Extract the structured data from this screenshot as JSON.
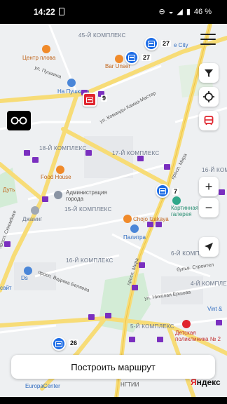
{
  "status_bar": {
    "time": "14:22",
    "battery": "46 %"
  },
  "map": {
    "districts": [
      "45-Й КОМПЛЕКС",
      "18-Й КОМПЛЕКС",
      "17-Й КОМПЛЕКС",
      "15-Й КОМПЛЕКС",
      "16-Й КОМПЛЕКС",
      "6-Й КОМПЛЕКС",
      "5-Й КОМПЛЕКС",
      "4-Й КОМПЛЕКС",
      "16-Й КОМПЛЕКС"
    ],
    "pois": {
      "centr_plova": "Центр плова",
      "bar_unser": "Bar Unser",
      "na_pushkina": "На Пушкина",
      "food_house": "Food House",
      "dut": "Дуть",
      "administraciya": "Администрация города",
      "dzhamig": "Джамиг",
      "kartinnaya": "Картинная галерея",
      "chojo": "Chojo Izakaya",
      "palitra": "Палитра",
      "city": "e City",
      "ds": "Ds",
      "sait": "сайт",
      "vint": "Vint &",
      "detskaya": "Детская поликлиника № 2",
      "europacenter": "EuropaCenter",
      "ngtii": "НГТИИ"
    },
    "streets": {
      "pushkina": "ул. Пушкина",
      "kamaz": "ул. Команды Камаз-Мастер",
      "mira_top": "просп. Мира",
      "mira_mid": "просп. Мира",
      "belyaeva": "просп. Вадима Беляева",
      "ershova": "ул. Николая Ершова",
      "stroitelei": "бульв. Строител",
      "sh": "просп. Сююмбике"
    },
    "buses": [
      {
        "route": "27",
        "color": "#1e6de6"
      },
      {
        "route": "27",
        "color": "#1e6de6"
      },
      {
        "route": "9",
        "color": "#e0242d"
      },
      {
        "route": "7",
        "color": "#1e6de6"
      },
      {
        "route": "26",
        "color": "#1e6de6"
      }
    ]
  },
  "controls": {
    "filter_icon": "filter-icon",
    "locate_icon": "crosshair-icon",
    "transport_icon": "bus-icon",
    "zoom_in": "+",
    "zoom_out": "−",
    "navigate_icon": "navigation-arrow-icon",
    "menu_icon": "hamburger-menu-icon",
    "accessibility_icon": "glasses-icon"
  },
  "route_button": {
    "label": "Построить маршрут"
  },
  "attribution": {
    "first": "Я",
    "rest": "ндекс"
  }
}
